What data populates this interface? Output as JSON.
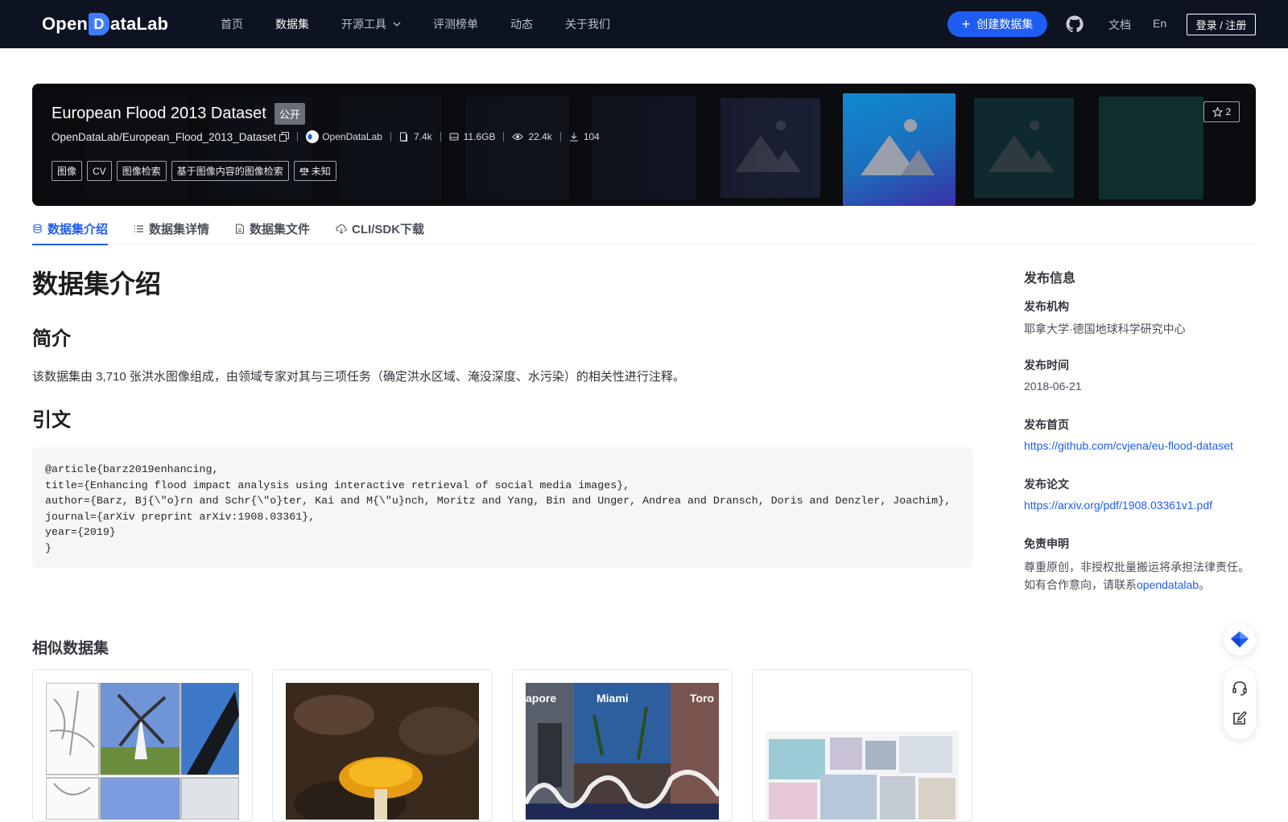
{
  "nav": {
    "logo_pre": "Open",
    "logo_mark": "D",
    "logo_post": "ataLab",
    "items": [
      {
        "label": "首页"
      },
      {
        "label": "数据集"
      },
      {
        "label": "开源工具"
      },
      {
        "label": "评测榜单"
      },
      {
        "label": "动态"
      },
      {
        "label": "关于我们"
      }
    ],
    "create_label": "创建数据集",
    "docs_label": "文档",
    "lang_label": "En",
    "login_label": "登录 / 注册"
  },
  "hero": {
    "title": "European Flood 2013 Dataset",
    "visibility": "公开",
    "path": "OpenDataLab/European_Flood_2013_Dataset",
    "org": "OpenDataLab",
    "stats": {
      "files": "7.4k",
      "size": "11.6GB",
      "views": "22.4k",
      "downloads": "104"
    },
    "tags": [
      "图像",
      "CV",
      "图像检索",
      "基于图像内容的图像检索"
    ],
    "license": "未知",
    "stars": "2"
  },
  "tabs": [
    {
      "label": "数据集介绍"
    },
    {
      "label": "数据集详情"
    },
    {
      "label": "数据集文件"
    },
    {
      "label": "CLI/SDK下载"
    }
  ],
  "main": {
    "title": "数据集介绍",
    "intro_heading": "简介",
    "intro_text": "该数据集由 3,710 张洪水图像组成，由领域专家对其与三项任务（确定洪水区域、淹没深度、水污染）的相关性进行注释。",
    "citation_heading": "引文",
    "citation": "@article{barz2019enhancing,\ntitle={Enhancing flood impact analysis using interactive retrieval of social media images},\nauthor={Barz, Bj{\\\"o}rn and Schr{\\\"o}ter, Kai and M{\\\"u}nch, Moritz and Yang, Bin and Unger, Andrea and Dransch, Doris and Denzler, Joachim},\njournal={arXiv preprint arXiv:1908.03361},\nyear={2019}\n}"
  },
  "similar": {
    "title": "相似数据集",
    "card3_labels": [
      "apore",
      "Miami",
      "Toro"
    ]
  },
  "sidebar": {
    "heading": "发布信息",
    "org_label": "发布机构",
    "org_value": "耶拿大学·德国地球科学研究中心",
    "date_label": "发布时间",
    "date_value": "2018-06-21",
    "home_label": "发布首页",
    "home_value": "https://github.com/cvjena/eu-flood-dataset",
    "paper_label": "发布论文",
    "paper_value": "https://arxiv.org/pdf/1908.03361v1.pdf",
    "disclaimer_label": "免责申明",
    "disclaimer_line1": "尊重原创，非授权批量搬运将承担法律责任。",
    "disclaimer_line2_pre": "如有合作意向，请联系",
    "disclaimer_link": "opendatalab",
    "disclaimer_line2_post": "。"
  },
  "colors": {
    "nav_bg": "#0d1321",
    "accent": "#1f5cf2",
    "hero_bg": "#0b0c10"
  }
}
